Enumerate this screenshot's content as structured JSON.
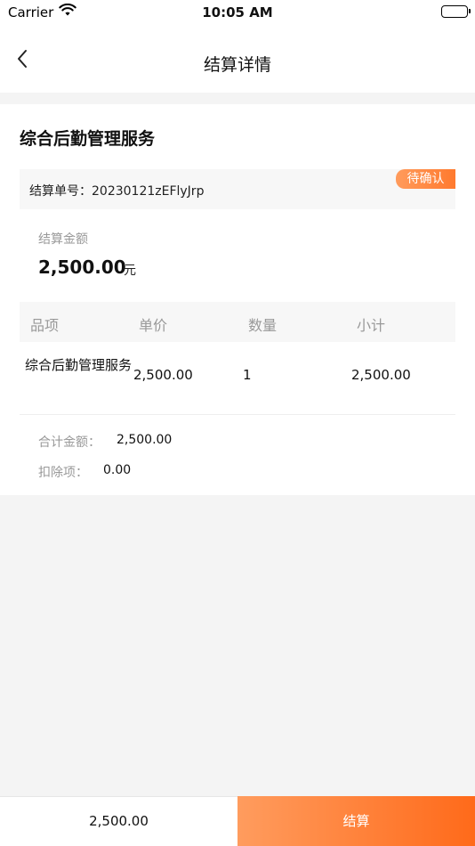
{
  "status_bar": {
    "carrier": "Carrier",
    "time": "10:05 AM"
  },
  "nav": {
    "title": "结算详情"
  },
  "service": {
    "title": "综合后勤管理服务"
  },
  "order": {
    "label": "结算单号：20230121zEFlyJrp",
    "status": "待确认"
  },
  "amount": {
    "label": "结算金额",
    "value": "2,500.00",
    "unit": "元"
  },
  "table": {
    "headers": [
      "品项",
      "单价",
      "数量",
      "小计"
    ],
    "rows": [
      {
        "name": "综合后勤管理服务",
        "price": "2,500.00",
        "qty": "1",
        "subtotal": "2,500.00"
      }
    ]
  },
  "summary": {
    "total_label": "合计金额：",
    "total_value": "2,500.00",
    "deduction_label": "扣除项：",
    "deduction_value": "0.00"
  },
  "bottom": {
    "total": "2,500.00",
    "settle_label": "结算"
  },
  "colors": {
    "accent": "#ff7a2e",
    "background": "#f4f4f4"
  }
}
